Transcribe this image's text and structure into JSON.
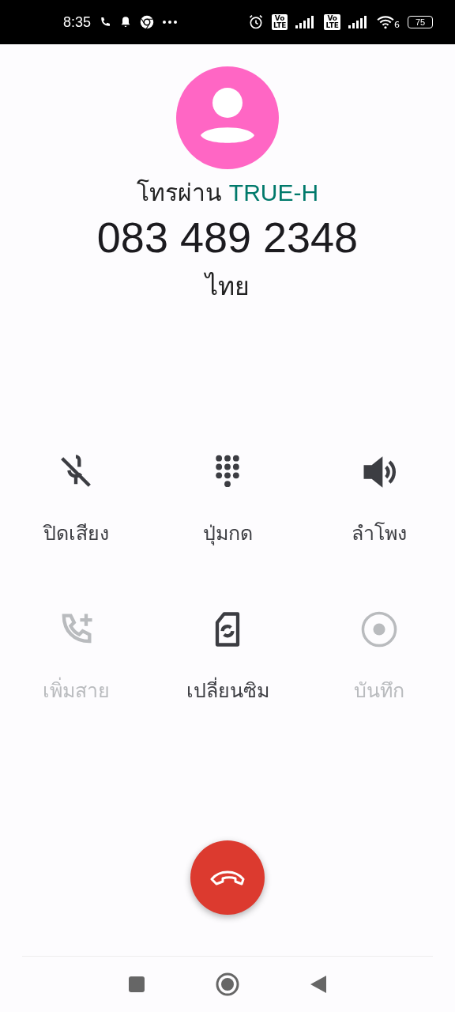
{
  "status_bar": {
    "time": "8:35",
    "sims": [
      {
        "top": "Vo",
        "bottom": "LTE"
      },
      {
        "top": "Vo",
        "bottom": "LTE"
      }
    ],
    "wifi_badge": "6",
    "battery": "75"
  },
  "caller": {
    "via_label": "โทรผ่าน",
    "carrier": "TRUE-H",
    "number": "083 489 2348",
    "location": "ไทย"
  },
  "controls": [
    {
      "kind": "mute",
      "label": "ปิดเสียง",
      "disabled": false
    },
    {
      "kind": "keypad",
      "label": "ปุ่มกด",
      "disabled": false
    },
    {
      "kind": "speaker",
      "label": "ลำโพง",
      "disabled": false
    },
    {
      "kind": "add_call",
      "label": "เพิ่มสาย",
      "disabled": true
    },
    {
      "kind": "switch_sim",
      "label": "เปลี่ยนซิม",
      "disabled": false
    },
    {
      "kind": "record",
      "label": "บันทึก",
      "disabled": true
    }
  ]
}
